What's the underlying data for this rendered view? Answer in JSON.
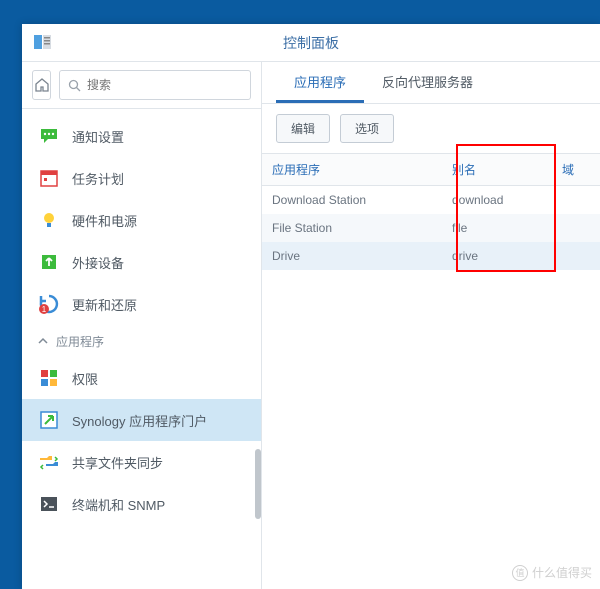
{
  "window": {
    "title": "控制面板"
  },
  "search": {
    "placeholder": "搜索"
  },
  "sidebar": {
    "items": [
      {
        "label": "通知设置"
      },
      {
        "label": "任务计划"
      },
      {
        "label": "硬件和电源"
      },
      {
        "label": "外接设备"
      },
      {
        "label": "更新和还原"
      }
    ],
    "section": {
      "label": "应用程序"
    },
    "apps": [
      {
        "label": "权限"
      },
      {
        "label": "Synology 应用程序门户"
      },
      {
        "label": "共享文件夹同步"
      },
      {
        "label": "终端机和 SNMP"
      }
    ]
  },
  "tabs": [
    {
      "label": "应用程序"
    },
    {
      "label": "反向代理服务器"
    }
  ],
  "toolbar": {
    "edit": "编辑",
    "options": "选项"
  },
  "table": {
    "headers": {
      "app": "应用程序",
      "alias": "别名",
      "domain": "域"
    },
    "rows": [
      {
        "app": "Download Station",
        "alias": "download"
      },
      {
        "app": "File Station",
        "alias": "file"
      },
      {
        "app": "Drive",
        "alias": "drive"
      }
    ]
  },
  "watermark": {
    "text": "什么值得买",
    "badge": "值"
  }
}
